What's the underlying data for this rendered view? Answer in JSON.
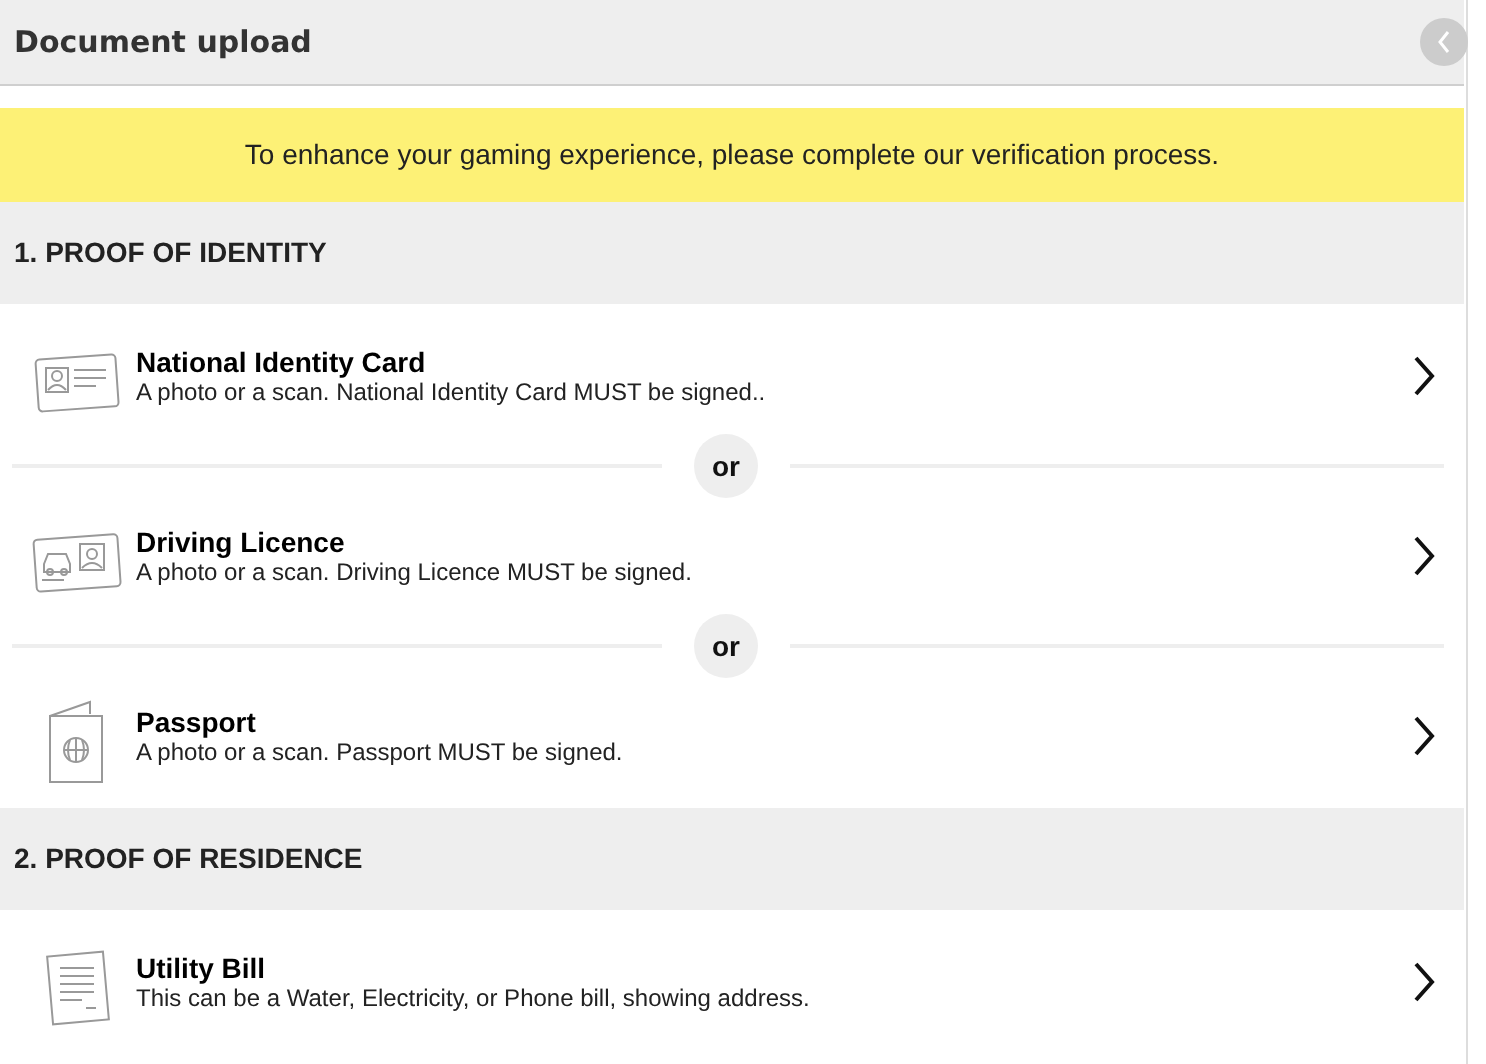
{
  "header": {
    "title": "Document upload"
  },
  "notice": "To enhance your gaming experience, please complete our verification process.",
  "sections": [
    {
      "title": "1. PROOF OF IDENTITY",
      "items": [
        {
          "kind": "document",
          "title": "National Identity Card",
          "description": "A photo or a scan. National Identity Card MUST be signed.."
        },
        {
          "kind": "separator",
          "label": "or"
        },
        {
          "kind": "document",
          "title": "Driving Licence",
          "description": "A photo or a scan. Driving Licence MUST be signed."
        },
        {
          "kind": "separator",
          "label": "or"
        },
        {
          "kind": "document",
          "title": "Passport",
          "description": "A photo or a scan. Passport MUST be signed."
        }
      ]
    },
    {
      "title": "2. PROOF OF RESIDENCE",
      "items": [
        {
          "kind": "document",
          "title": "Utility Bill",
          "description": "This can be a Water, Electricity, or Phone bill, showing address."
        }
      ]
    }
  ]
}
